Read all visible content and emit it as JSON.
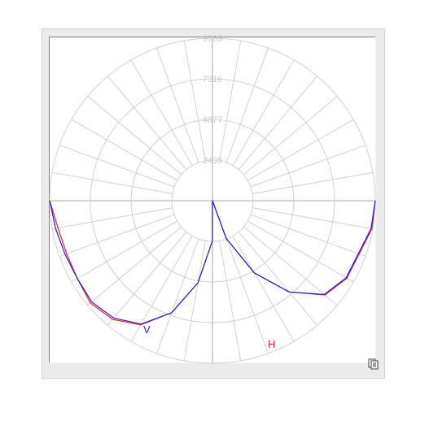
{
  "chart_data": {
    "type": "polar",
    "radial_ticks": [
      "2439",
      "4877",
      "7316",
      "9755"
    ],
    "r_max": 9755,
    "angle_step_deg": 10,
    "grid": true,
    "series": [
      {
        "name": "H",
        "color": "#e8202a",
        "angles_deg": [
          0,
          10,
          20,
          30,
          40,
          50,
          60,
          70,
          80,
          90,
          100,
          110,
          120,
          130,
          140,
          150,
          160,
          170,
          180,
          190,
          200,
          210,
          220,
          230,
          240,
          250,
          260,
          270,
          280,
          290,
          300,
          310,
          320,
          330,
          340,
          350,
          360
        ],
        "r": [
          9750,
          9400,
          9300,
          9350,
          9550,
          9300,
          8600,
          7150,
          5000,
          2400,
          0,
          2400,
          5000,
          7150,
          8800,
          9300,
          9350,
          9700,
          9750
        ]
      },
      {
        "name": "V",
        "color": "#2020d0",
        "angles_deg": [
          0,
          10,
          20,
          30,
          40,
          50,
          60,
          70,
          80,
          90,
          100,
          110,
          120,
          130,
          140,
          150,
          160,
          170,
          180,
          190,
          200,
          210,
          220,
          230,
          240,
          250,
          260,
          270,
          280,
          290,
          300,
          310,
          320,
          330,
          340,
          350,
          360
        ],
        "r": [
          9750,
          9550,
          9400,
          9350,
          9450,
          9200,
          8550,
          7150,
          5000,
          2400,
          0,
          2400,
          5000,
          7150,
          8750,
          9250,
          9300,
          9650,
          9750
        ]
      }
    ]
  },
  "toolbar": {
    "icon": "copy-icon"
  }
}
